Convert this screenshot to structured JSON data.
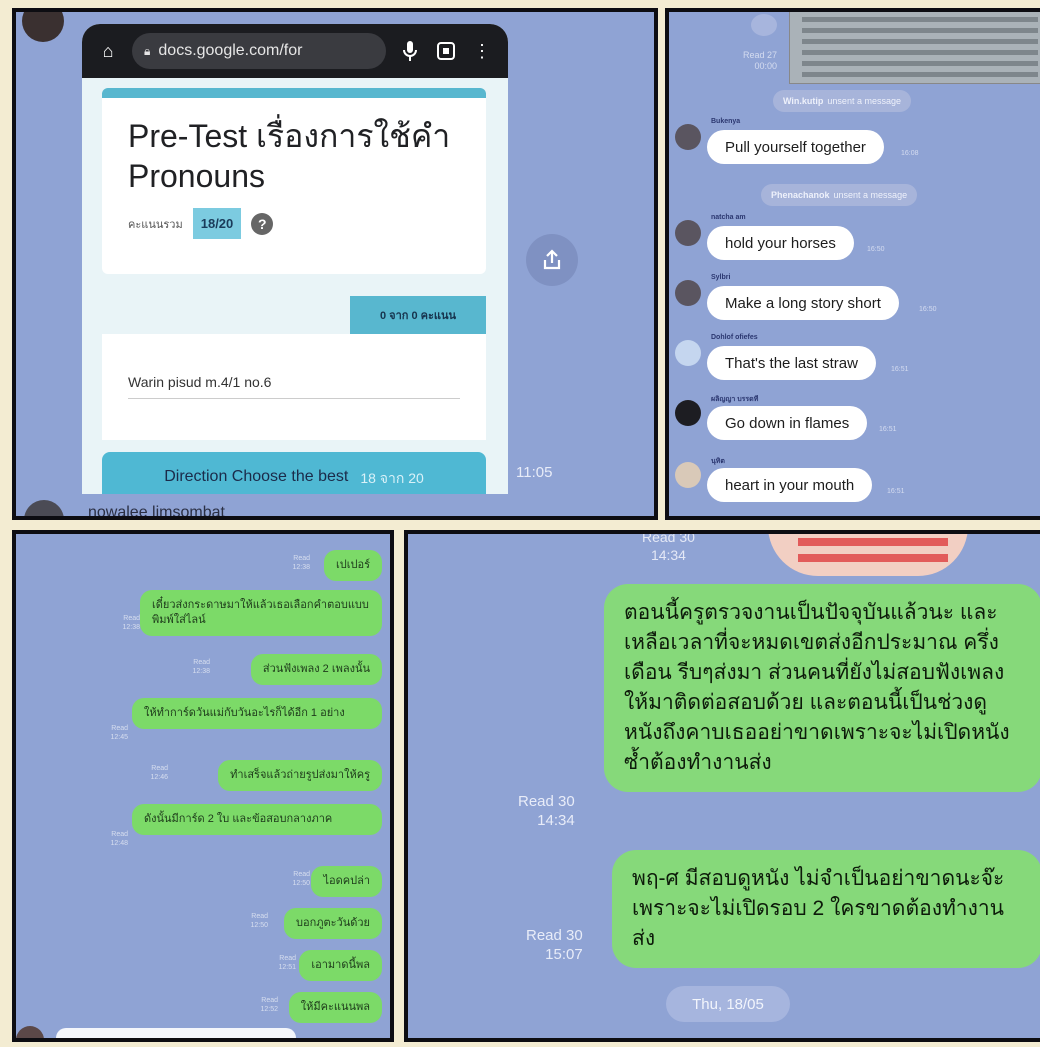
{
  "panel1": {
    "url": "docs.google.com/for",
    "form_title": "Pre-Test เรื่องการใช้คำ Pronouns",
    "score_label": "คะแนนรวม",
    "score": "18/20",
    "help_icon": "?",
    "points_label": "0 จาก 0 คะแนน",
    "answer": "Warin pisud m.4/1 no.6",
    "direction": "Direction Choose the best",
    "direction_score": "18 จาก 20",
    "time": "11:05",
    "bottom_name": "nowalee limsombat"
  },
  "panel2": {
    "read": "Read 27\n00:00",
    "notices": [
      {
        "name": "Win.kutip",
        "text": "unsent a message"
      },
      {
        "name": "Phenachanok",
        "text": "unsent a message"
      }
    ],
    "messages": [
      {
        "name": "Bukenya",
        "text": "Pull yourself together",
        "time": "16:08"
      },
      {
        "name": "natcha am",
        "text": "hold your horses",
        "time": "16:50"
      },
      {
        "name": "Sylbri",
        "text": "Make a long story short",
        "time": "16:50"
      },
      {
        "name": "Dohlof ofiefes",
        "text": "That's the last straw",
        "time": "16:51"
      },
      {
        "name": "ผลิญญา บรรดที",
        "text": "Go down in flames",
        "time": "16:51"
      },
      {
        "name": "นุทิต",
        "text": "heart in your mouth",
        "time": "16:51"
      }
    ]
  },
  "panel3": {
    "messages": [
      {
        "text": "เปเปอร์",
        "read": "Read\n12:38"
      },
      {
        "text": "เดี๋ยวส่งกระดาษมาให้แล้วเธอเลือกคำตอบแบบพิมพ์ใส่ไลน์",
        "read": "Read\n12:38"
      },
      {
        "text": "ส่วนฟังเพลง 2 เพลงนั้น",
        "read": "Read\n12:38"
      },
      {
        "text": "ให้ทำการ์ดวันแม่กับวันอะไรก็ได้อีก 1 อย่าง",
        "read": "Read\n12:45"
      },
      {
        "text": "ทำเสร็จแล้วถ่ายรูปส่งมาให้ครู",
        "read": "Read\n12:46"
      },
      {
        "text": "ดังนั้นมีการ์ด 2 ใบ และข้อสอบกลางภาค",
        "read": "Read\n12:48"
      },
      {
        "text": "ไอดคปล่า",
        "read": "Read\n12:50"
      },
      {
        "text": "บอกภูตะวันด้วย",
        "read": "Read\n12:50"
      },
      {
        "text": "เอามาดนี้พล",
        "read": "Read\n12:51"
      },
      {
        "text": "ให้มีคะแนนพล",
        "read": "Read\n12:52"
      }
    ]
  },
  "panel4": {
    "top_read": "Read 30\n14:34",
    "messages": [
      {
        "text": "ตอนนี้ครูตรวจงานเป็นปัจจุบันแล้วนะ และเหลือเวลาที่จะหมดเขตส่งอีกประมาณ ครึ่งเดือน รีบๆส่งมา ส่วนคนที่ยังไม่สอบฟังเพลงให้มาติดต่อสอบด้วย และตอนนี้เป็นช่วงดูหนังถึงคาบเธออย่าขาดเพราะจะไม่เปิดหนังซ้ำต้องทำงานส่ง",
        "read": "Read 30\n14:34"
      },
      {
        "text": "พฤ-ศ มีสอบดูหนัง ไม่จำเป็นอย่าขาดนะจ๊ะเพราะจะไม่เปิดรอบ 2 ใครขาดต้องทำงานส่ง",
        "read": "Read 30\n15:07"
      }
    ],
    "date": "Thu, 18/05"
  },
  "colors": {
    "chat_bg": "#8fa3d4",
    "green_bubble": "#7cda68",
    "form_accent": "#58b7cf"
  }
}
